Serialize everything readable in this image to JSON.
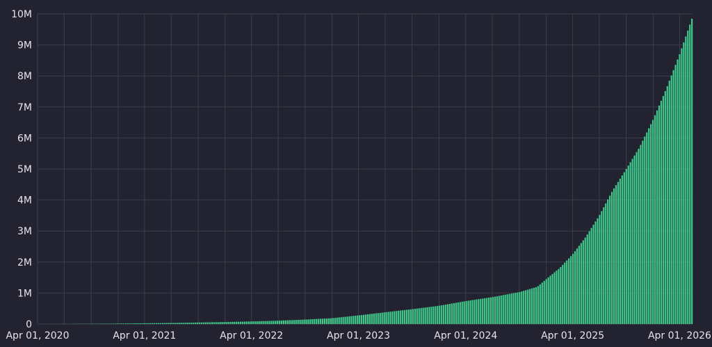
{
  "theme": {
    "background": "#222230",
    "grid_color": "#3d3d4b",
    "bar_color": "#3ecf8e",
    "bar_edge_color": "#1f6b48",
    "text_color": "#e6e6ea"
  },
  "chart_data": {
    "type": "bar",
    "title": "",
    "xlabel": "",
    "ylabel": "",
    "grid": true,
    "legend": "none",
    "x_start": "2020-04-01",
    "x_end": "2026-05-15",
    "bar_interval_days": 7,
    "ylim": [
      0,
      10000000
    ],
    "y_ticks": [
      {
        "value": 0,
        "label": "0"
      },
      {
        "value": 1000000,
        "label": "1M"
      },
      {
        "value": 2000000,
        "label": "2M"
      },
      {
        "value": 3000000,
        "label": "3M"
      },
      {
        "value": 4000000,
        "label": "4M"
      },
      {
        "value": 5000000,
        "label": "5M"
      },
      {
        "value": 6000000,
        "label": "6M"
      },
      {
        "value": 7000000,
        "label": "7M"
      },
      {
        "value": 8000000,
        "label": "8M"
      },
      {
        "value": 9000000,
        "label": "9M"
      },
      {
        "value": 10000000,
        "label": "10M"
      }
    ],
    "x_ticks": [
      {
        "date": "2020-04-01",
        "label": "Apr 01, 2020"
      },
      {
        "date": "2021-04-01",
        "label": "Apr 01, 2021"
      },
      {
        "date": "2022-04-01",
        "label": "Apr 01, 2022"
      },
      {
        "date": "2023-04-01",
        "label": "Apr 01, 2023"
      },
      {
        "date": "2024-04-01",
        "label": "Apr 01, 2024"
      },
      {
        "date": "2025-04-01",
        "label": "Apr 01, 2025"
      },
      {
        "date": "2026-04-01",
        "label": "Apr 01, 2026"
      }
    ],
    "x_minor_gridlines": [
      "2020-07-01",
      "2020-10-01",
      "2021-01-01",
      "2021-07-01",
      "2021-10-01",
      "2022-01-01",
      "2022-07-01",
      "2022-10-01",
      "2023-01-01",
      "2023-07-01",
      "2023-10-01",
      "2024-01-01",
      "2024-07-01",
      "2024-10-01",
      "2025-01-01",
      "2025-07-01",
      "2025-10-01",
      "2026-01-01"
    ],
    "series": [
      {
        "points": [
          {
            "date": "2020-04-01",
            "value": 0
          },
          {
            "date": "2020-07-01",
            "value": 3000
          },
          {
            "date": "2020-10-01",
            "value": 8000
          },
          {
            "date": "2021-01-01",
            "value": 15000
          },
          {
            "date": "2021-04-01",
            "value": 25000
          },
          {
            "date": "2021-07-01",
            "value": 35000
          },
          {
            "date": "2021-10-01",
            "value": 50000
          },
          {
            "date": "2022-01-01",
            "value": 65000
          },
          {
            "date": "2022-04-01",
            "value": 85000
          },
          {
            "date": "2022-07-01",
            "value": 110000
          },
          {
            "date": "2022-10-01",
            "value": 145000
          },
          {
            "date": "2023-01-01",
            "value": 190000
          },
          {
            "date": "2023-04-01",
            "value": 280000
          },
          {
            "date": "2023-07-01",
            "value": 380000
          },
          {
            "date": "2023-10-01",
            "value": 480000
          },
          {
            "date": "2024-01-01",
            "value": 590000
          },
          {
            "date": "2024-04-01",
            "value": 740000
          },
          {
            "date": "2024-07-01",
            "value": 870000
          },
          {
            "date": "2024-10-01",
            "value": 1030000
          },
          {
            "date": "2024-12-01",
            "value": 1200000
          },
          {
            "date": "2025-01-01",
            "value": 1450000
          },
          {
            "date": "2025-02-15",
            "value": 1800000
          },
          {
            "date": "2025-04-01",
            "value": 2250000
          },
          {
            "date": "2025-05-15",
            "value": 2800000
          },
          {
            "date": "2025-07-01",
            "value": 3500000
          },
          {
            "date": "2025-08-15",
            "value": 4300000
          },
          {
            "date": "2025-10-01",
            "value": 5000000
          },
          {
            "date": "2025-11-15",
            "value": 5700000
          },
          {
            "date": "2026-01-01",
            "value": 6600000
          },
          {
            "date": "2026-02-15",
            "value": 7600000
          },
          {
            "date": "2026-04-01",
            "value": 8700000
          },
          {
            "date": "2026-05-15",
            "value": 9900000
          }
        ]
      }
    ]
  }
}
